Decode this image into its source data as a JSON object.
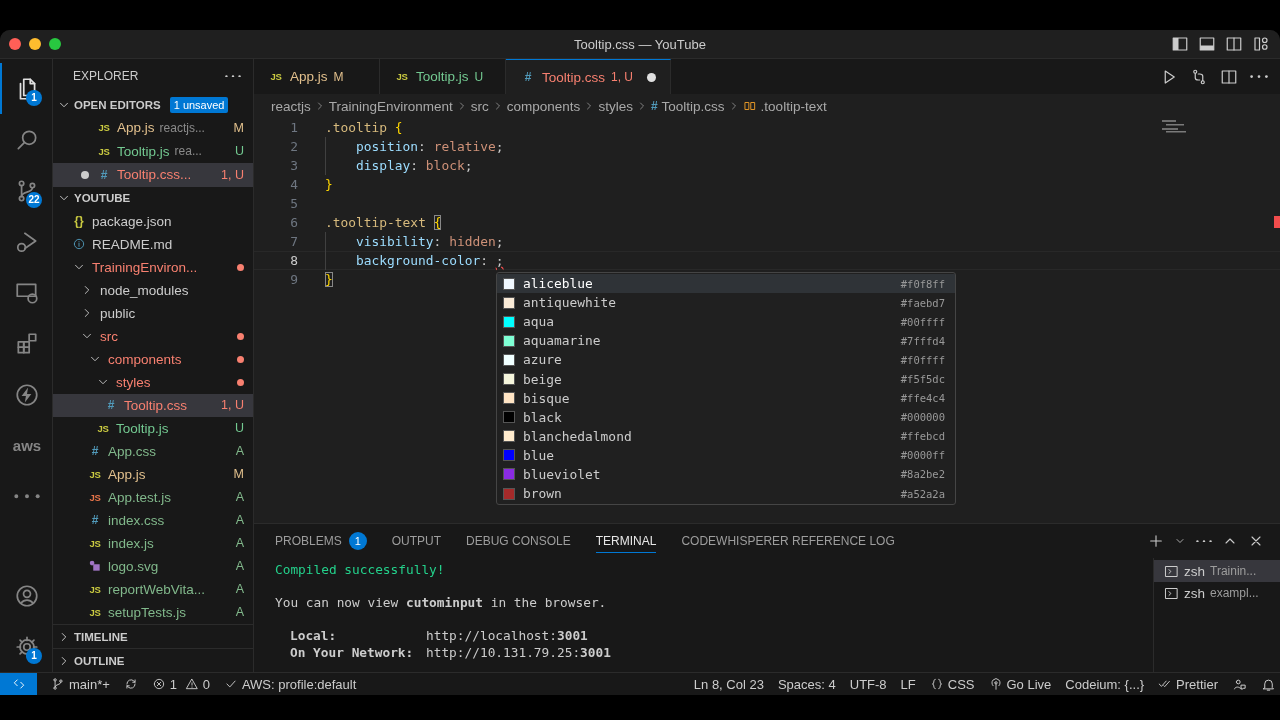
{
  "window": {
    "title": "Tooltip.css — YouTube"
  },
  "activity_bar": {
    "items": [
      {
        "kind": "explorer",
        "selected": true,
        "badge": "1"
      },
      {
        "kind": "search",
        "selected": false
      },
      {
        "kind": "source-control",
        "selected": false,
        "badge": "22"
      },
      {
        "kind": "run-debug",
        "selected": false
      },
      {
        "kind": "remote",
        "selected": false
      },
      {
        "kind": "extensions",
        "selected": false
      },
      {
        "kind": "lightning",
        "selected": false
      },
      {
        "kind": "aws",
        "selected": false,
        "label": "aws"
      },
      {
        "kind": "more",
        "selected": false
      }
    ],
    "bottom": [
      {
        "kind": "account"
      },
      {
        "kind": "gear",
        "badge": "1"
      }
    ]
  },
  "sidebar": {
    "title": "EXPLORER",
    "open_editors": {
      "label": "OPEN EDITORS",
      "badge": "1 unsaved",
      "expanded": true,
      "items": [
        {
          "kind": "js",
          "icon_text": "JS",
          "name": "App.js",
          "detail": "reactjs...",
          "status": "M",
          "color": "#e2c08d",
          "dirty": false,
          "selected": false
        },
        {
          "kind": "js",
          "icon_text": "JS",
          "name": "Tooltip.js",
          "detail": "rea...",
          "status": "U",
          "color": "#73c991",
          "dirty": false,
          "selected": false
        },
        {
          "kind": "css",
          "icon_text": "#",
          "name": "Tooltip.css...",
          "status": "1, U",
          "color": "#f88070",
          "dirty": true,
          "selected": true
        }
      ]
    },
    "folder": {
      "label": "YOUTUBE",
      "expanded": true,
      "items": [
        {
          "kind": "json",
          "icon_text": "{}",
          "name": "package.json",
          "selected": false
        },
        {
          "kind": "info",
          "name": "README.md",
          "selected": false
        },
        {
          "kind": "folder",
          "name": "TrainingEnviron...",
          "color": "#f88070",
          "expanded": true,
          "selected": false,
          "children": [
            {
              "kind": "folder",
              "name": "node_modules",
              "expanded": false,
              "selected": false
            },
            {
              "kind": "folder",
              "name": "public",
              "expanded": false,
              "selected": false
            },
            {
              "kind": "folder",
              "name": "src",
              "color": "#f88070",
              "expanded": true,
              "selected": false,
              "children": [
                {
                  "kind": "folder",
                  "name": "components",
                  "color": "#f88070",
                  "expanded": true,
                  "selected": false,
                  "children": [
                    {
                      "kind": "folder",
                      "name": "styles",
                      "color": "#f88070",
                      "expanded": true,
                      "selected": false,
                      "children": [
                        {
                          "kind": "css",
                          "icon_text": "#",
                          "name": "Tooltip.css",
                          "status": "1, U",
                          "color": "#f88070",
                          "selected": true
                        }
                      ]
                    },
                    {
                      "kind": "js",
                      "icon_text": "JS",
                      "name": "Tooltip.js",
                      "status": "U",
                      "color": "#73c991",
                      "selected": false
                    }
                  ]
                },
                {
                  "kind": "css",
                  "icon_text": "#",
                  "name": "App.css",
                  "status": "A",
                  "color": "#81b88b",
                  "selected": false
                },
                {
                  "kind": "js",
                  "icon_text": "JS",
                  "name": "App.js",
                  "status": "M",
                  "color": "#e2c08d",
                  "selected": false
                },
                {
                  "kind": "js-test",
                  "icon_text": "JS",
                  "name": "App.test.js",
                  "status": "A",
                  "color": "#81b88b",
                  "selected": false
                },
                {
                  "kind": "css",
                  "icon_text": "#",
                  "name": "index.css",
                  "status": "A",
                  "color": "#81b88b",
                  "selected": false
                },
                {
                  "kind": "js",
                  "icon_text": "JS",
                  "name": "index.js",
                  "status": "A",
                  "color": "#81b88b",
                  "selected": false
                },
                {
                  "kind": "image",
                  "name": "logo.svg",
                  "status": "A",
                  "color": "#81b88b",
                  "selected": false
                },
                {
                  "kind": "js",
                  "icon_text": "JS",
                  "name": "reportWebVita...",
                  "status": "A",
                  "color": "#81b88b",
                  "selected": false
                },
                {
                  "kind": "js",
                  "icon_text": "JS",
                  "name": "setupTests.js",
                  "status": "A",
                  "color": "#81b88b",
                  "selected": false
                }
              ]
            }
          ]
        }
      ]
    },
    "sections": [
      {
        "label": "TIMELINE",
        "expanded": false
      },
      {
        "label": "OUTLINE",
        "expanded": false
      }
    ]
  },
  "editor": {
    "tabs": [
      {
        "kind": "js",
        "icon_text": "JS",
        "label": "App.js",
        "status": "M",
        "color": "#e2c08d",
        "dirty": false,
        "selected": false
      },
      {
        "kind": "js",
        "icon_text": "JS",
        "label": "Tooltip.js",
        "status": "U",
        "color": "#73c991",
        "dirty": false,
        "selected": false
      },
      {
        "kind": "css",
        "icon_text": "#",
        "label": "Tooltip.css",
        "status": "1, U",
        "color": "#f88070",
        "dirty": true,
        "selected": true
      }
    ],
    "breadcrumb": [
      {
        "label": "reactjs"
      },
      {
        "label": "TrainingEnvironment"
      },
      {
        "label": "src"
      },
      {
        "label": "components"
      },
      {
        "label": "styles"
      },
      {
        "label": "Tooltip.css",
        "kind": "css",
        "icon_text": "#"
      },
      {
        "label": ".tooltip-text",
        "kind": "selector"
      }
    ],
    "lines": [
      {
        "number": "1",
        "active": false,
        "indented": false,
        "tokens": [
          {
            "text": ".tooltip",
            "kind": "selector"
          },
          {
            "text": " {",
            "kind": "brace"
          }
        ]
      },
      {
        "number": "2",
        "active": false,
        "indented": true,
        "tokens": [
          {
            "text": "position",
            "kind": "property"
          },
          {
            "text": ": ",
            "kind": "punct"
          },
          {
            "text": "relative",
            "kind": "value"
          },
          {
            "text": ";",
            "kind": "punct"
          }
        ]
      },
      {
        "number": "3",
        "active": false,
        "indented": true,
        "tokens": [
          {
            "text": "display",
            "kind": "property"
          },
          {
            "text": ": ",
            "kind": "punct"
          },
          {
            "text": "block",
            "kind": "value"
          },
          {
            "text": ";",
            "kind": "punct"
          }
        ]
      },
      {
        "number": "4",
        "active": false,
        "indented": false,
        "tokens": [
          {
            "text": "}",
            "kind": "brace"
          }
        ]
      },
      {
        "number": "5",
        "active": false
      },
      {
        "number": "6",
        "active": false,
        "indented": false,
        "tokens": [
          {
            "text": ".tooltip-text ",
            "kind": "selector"
          },
          {
            "text": "{",
            "kind": "matched-brace"
          }
        ]
      },
      {
        "number": "7",
        "active": false,
        "indented": true,
        "tokens": [
          {
            "text": "visibility",
            "kind": "property"
          },
          {
            "text": ": ",
            "kind": "punct"
          },
          {
            "text": "hidden",
            "kind": "value"
          },
          {
            "text": ";",
            "kind": "punct"
          }
        ]
      },
      {
        "number": "8",
        "active": true,
        "indented": true,
        "tokens": [
          {
            "text": "background-color",
            "kind": "property"
          },
          {
            "text": ": ",
            "kind": "punct"
          },
          {
            "text": ";",
            "kind": "error-punct"
          }
        ]
      },
      {
        "number": "9",
        "active": false,
        "indented": false,
        "tokens": [
          {
            "text": "}",
            "kind": "matched-brace"
          }
        ]
      }
    ],
    "suggestions": [
      {
        "label": "aliceblue",
        "hex": "#f0f8ff",
        "color": "#f0f8ff",
        "selected": true
      },
      {
        "label": "antiquewhite",
        "hex": "#faebd7",
        "color": "#faebd7",
        "selected": false
      },
      {
        "label": "aqua",
        "hex": "#00ffff",
        "color": "#00ffff",
        "selected": false
      },
      {
        "label": "aquamarine",
        "hex": "#7fffd4",
        "color": "#7fffd4",
        "selected": false
      },
      {
        "label": "azure",
        "hex": "#f0ffff",
        "color": "#f0ffff",
        "selected": false
      },
      {
        "label": "beige",
        "hex": "#f5f5dc",
        "color": "#f5f5dc",
        "selected": false
      },
      {
        "label": "bisque",
        "hex": "#ffe4c4",
        "color": "#ffe4c4",
        "selected": false
      },
      {
        "label": "black",
        "hex": "#000000",
        "color": "#000000",
        "selected": false
      },
      {
        "label": "blanchedalmond",
        "hex": "#ffebcd",
        "color": "#ffebcd",
        "selected": false
      },
      {
        "label": "blue",
        "hex": "#0000ff",
        "color": "#0000ff",
        "selected": false
      },
      {
        "label": "blueviolet",
        "hex": "#8a2be2",
        "color": "#8a2be2",
        "selected": false
      },
      {
        "label": "brown",
        "hex": "#a52a2a",
        "color": "#a52a2a",
        "selected": false
      }
    ]
  },
  "panel": {
    "tabs": [
      {
        "label": "PROBLEMS",
        "badge": "1",
        "selected": false
      },
      {
        "label": "OUTPUT",
        "selected": false
      },
      {
        "label": "DEBUG CONSOLE",
        "selected": false
      },
      {
        "label": "TERMINAL",
        "selected": true
      },
      {
        "label": "CODEWHISPERER REFERENCE LOG",
        "selected": false
      }
    ],
    "terminal_lines": [
      {
        "kind": "success",
        "text": "Compiled successfully!"
      },
      {
        "kind": "blank"
      },
      {
        "kind": "text",
        "text": "You can now view **cutominput** in the browser."
      },
      {
        "kind": "blank"
      },
      {
        "kind": "address",
        "label": "Local:",
        "value": "http://localhost:**3001**"
      },
      {
        "kind": "address",
        "label": "On Your Network:",
        "value": "http://10.131.79.25:**3001**"
      }
    ],
    "terminals": [
      {
        "shell": "zsh",
        "name": "Trainin...",
        "selected": true
      },
      {
        "shell": "zsh",
        "name": "exampl...",
        "selected": false
      }
    ]
  },
  "status_bar": {
    "left": [
      {
        "kind": "remote"
      },
      {
        "kind": "branch",
        "text": "main*+"
      },
      {
        "kind": "sync"
      },
      {
        "kind": "problems",
        "errors": "1",
        "warnings": "0"
      },
      {
        "kind": "check",
        "text": "AWS: profile:default"
      }
    ],
    "right": [
      {
        "kind": "text",
        "text": "Ln 8, Col 23"
      },
      {
        "kind": "text",
        "text": "Spaces: 4"
      },
      {
        "kind": "text",
        "text": "UTF-8"
      },
      {
        "kind": "text",
        "text": "LF"
      },
      {
        "kind": "braces",
        "text": "CSS"
      },
      {
        "kind": "broadcast",
        "text": "Go Live"
      },
      {
        "kind": "text",
        "text": "Codeium: {...}"
      },
      {
        "kind": "double-check",
        "text": "Prettier"
      },
      {
        "kind": "feedback"
      },
      {
        "kind": "bell"
      }
    ]
  }
}
